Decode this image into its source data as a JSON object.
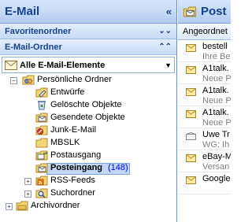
{
  "nav": {
    "title": "E-Mail",
    "favorites_header": "Favoritenordner",
    "mail_folders_header": "E-Mail-Ordner",
    "all_items_label": "Alle E-Mail-Elemente",
    "tree": {
      "root_label": "Persönliche Ordner",
      "folders": [
        {
          "label": "Entwürfe",
          "icon": "drafts-icon"
        },
        {
          "label": "Gelöschte Objekte",
          "icon": "deleted-items-icon"
        },
        {
          "label": "Gesendete Objekte",
          "icon": "sent-items-icon"
        },
        {
          "label": "Junk-E-Mail",
          "icon": "junk-mail-icon"
        },
        {
          "label": "MBSLK",
          "icon": "folder-icon"
        },
        {
          "label": "Postausgang",
          "icon": "outbox-icon"
        },
        {
          "label": "Posteingang",
          "icon": "inbox-icon",
          "count": "(148)",
          "selected": true
        },
        {
          "label": "RSS-Feeds",
          "icon": "rss-icon"
        },
        {
          "label": "Suchordner",
          "icon": "search-folder-icon"
        }
      ],
      "archive_label": "Archivordner"
    }
  },
  "list": {
    "title": "Post",
    "arrange_label": "Angeordnet",
    "items": [
      {
        "sender": "bestell",
        "preview": "Ihre Be"
      },
      {
        "sender": "A1talk.",
        "preview": "Neue P"
      },
      {
        "sender": "A1talk.",
        "preview": "Neue P"
      },
      {
        "sender": "A1talk.",
        "preview": "Neue P"
      },
      {
        "sender": "Uwe Tr",
        "preview": "WG: Ih"
      },
      {
        "sender": "eBay-M",
        "preview": "Versan"
      },
      {
        "sender": "Google",
        "preview": ""
      }
    ]
  },
  "colors": {
    "header_text": "#15428b",
    "selection": "#c1d7f5",
    "count": "#0000ff"
  }
}
